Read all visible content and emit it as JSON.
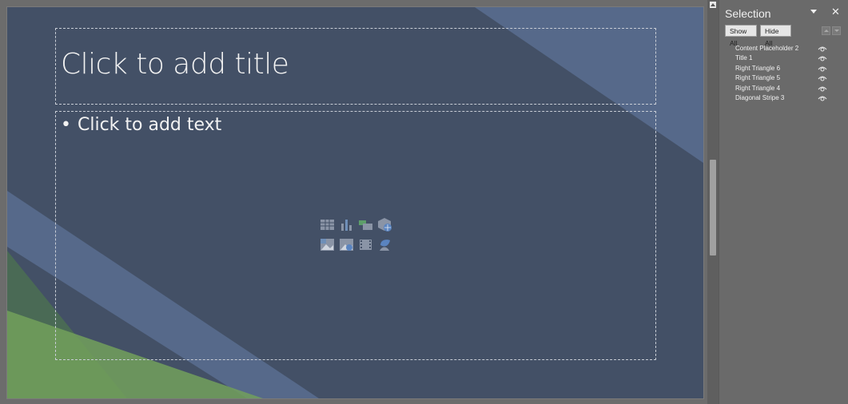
{
  "slide": {
    "title_placeholder": "Click to add title",
    "content_placeholder": "Click to add text",
    "bullet": "•",
    "colors": {
      "background": "#435066",
      "stripe_light": "#56698a",
      "green_dark": "#4a6a55",
      "green_light": "#6e9e5a"
    },
    "insert_icons": [
      "insert-table-icon",
      "insert-chart-icon",
      "insert-smartart-icon",
      "insert-3d-model-icon",
      "insert-picture-icon",
      "insert-online-picture-icon",
      "insert-video-icon",
      "insert-icons-icon"
    ]
  },
  "selection_pane": {
    "title": "Selection",
    "close_glyph": "✕",
    "show_all_label": "Show All",
    "hide_all_label": "Hide All",
    "items": [
      {
        "label": "Content Placeholder 2",
        "visible": true
      },
      {
        "label": "Title 1",
        "visible": true
      },
      {
        "label": "Right Triangle 6",
        "visible": true
      },
      {
        "label": "Right Triangle 5",
        "visible": true
      },
      {
        "label": "Right Triangle 4",
        "visible": true
      },
      {
        "label": "Diagonal Stripe 3",
        "visible": true
      }
    ]
  }
}
